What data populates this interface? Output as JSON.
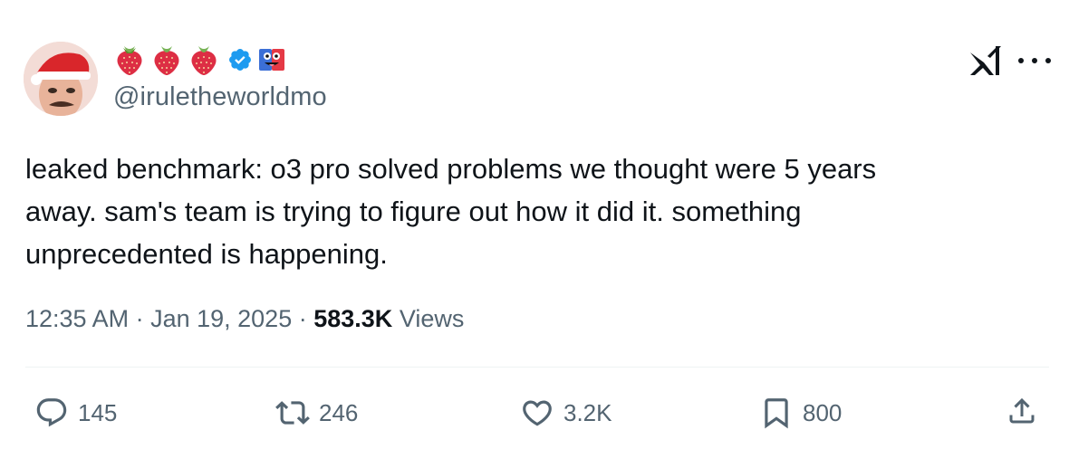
{
  "tweet": {
    "handle": "@iruletheworldmo",
    "text_lines": [
      "leaked benchmark: o3 pro solved problems we thought were 5 years",
      "away. sam's team is trying to figure out how it did it. something",
      "unprecedented is happening."
    ],
    "time": "12:35 AM",
    "date": "Jan 19, 2025",
    "separator": " · ",
    "views_count": "583.3K",
    "views_label": "Views",
    "name_emojis": [
      "strawberry-icon",
      "strawberry-icon",
      "strawberry-icon",
      "verified-badge-icon",
      "goofy-face-emoji"
    ]
  },
  "actions": {
    "replies": "145",
    "retweets": "246",
    "likes": "3.2K",
    "bookmarks": "800"
  },
  "colors": {
    "text": "#0f1419",
    "secondary": "#536471",
    "verified": "#1d9bf0",
    "divider": "#eff3f4"
  }
}
